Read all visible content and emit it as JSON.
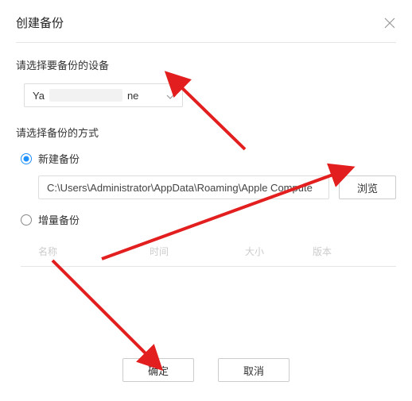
{
  "dialog": {
    "title": "创建备份",
    "close_label": "close"
  },
  "device": {
    "section_label": "请选择要备份的设备",
    "selected_prefix": "Ya",
    "selected_suffix": "ne"
  },
  "method": {
    "section_label": "请选择备份的方式",
    "new_backup": {
      "label": "新建备份",
      "path": "C:\\Users\\Administrator\\AppData\\Roaming\\Apple Compute",
      "browse_label": "浏览"
    },
    "incremental": {
      "label": "增量备份",
      "columns": {
        "name": "名称",
        "time": "时间",
        "size": "大小",
        "version": "版本"
      }
    }
  },
  "footer": {
    "ok_label": "确定",
    "cancel_label": "取消"
  }
}
